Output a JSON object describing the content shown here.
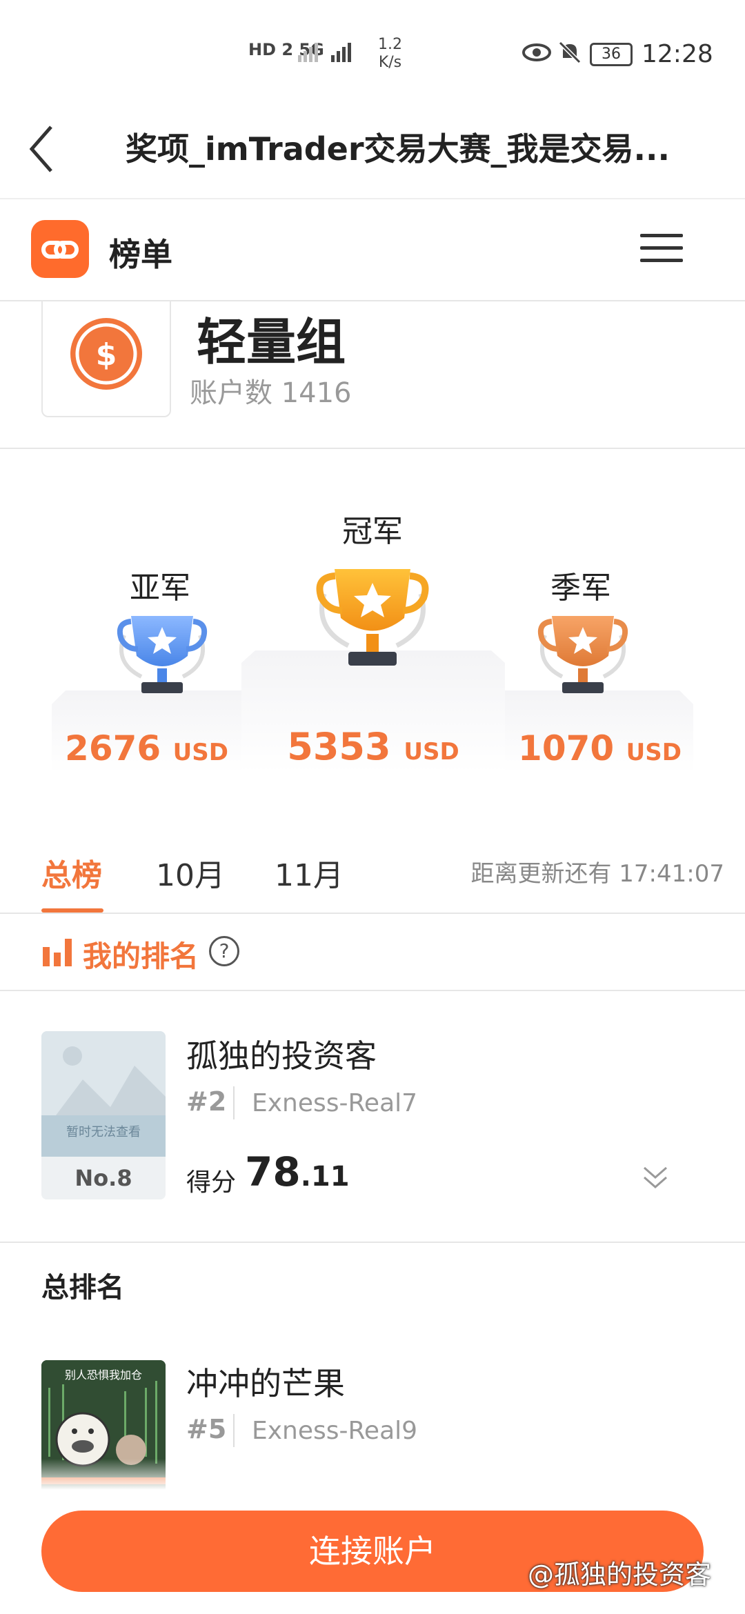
{
  "status_bar": {
    "network": "HD 2  5G",
    "speed_value": "1.2",
    "speed_unit": "K/s",
    "battery": "36",
    "time": "12:28"
  },
  "header": {
    "title": "奖项_imTrader交易大赛_我是交易..."
  },
  "brand": {
    "name": "榜单"
  },
  "group": {
    "name": "轻量组",
    "accounts": "账户数 1416"
  },
  "podium": {
    "second": {
      "label": "亚军",
      "amount": "2676",
      "unit": "USD"
    },
    "first": {
      "label": "冠军",
      "amount": "5353",
      "unit": "USD"
    },
    "third": {
      "label": "季军",
      "amount": "1070",
      "unit": "USD"
    }
  },
  "tabs": {
    "items": [
      "总榜",
      "10月",
      "11月"
    ],
    "countdown": "距离更新还有 17:41:07"
  },
  "my_rank": {
    "title": "我的排名",
    "avatar_text": "暂时无法查看",
    "avatar_rank": "No.8",
    "nickname": "孤独的投资客",
    "rank": "#2",
    "account": "Exness-Real7",
    "score_label": "得分",
    "score_int": "78",
    "score_dec": ".11"
  },
  "overall": {
    "title": "总排名",
    "entry": {
      "avatar_text": "别人恐惧我加仓",
      "nickname": "冲冲的芒果",
      "rank": "#5",
      "account": "Exness-Real9"
    }
  },
  "bottom": {
    "connect_label": "连接账户",
    "watermark": "@孤独的投资客"
  },
  "colors": {
    "accent": "#f2763c",
    "button": "#ff6b35"
  }
}
